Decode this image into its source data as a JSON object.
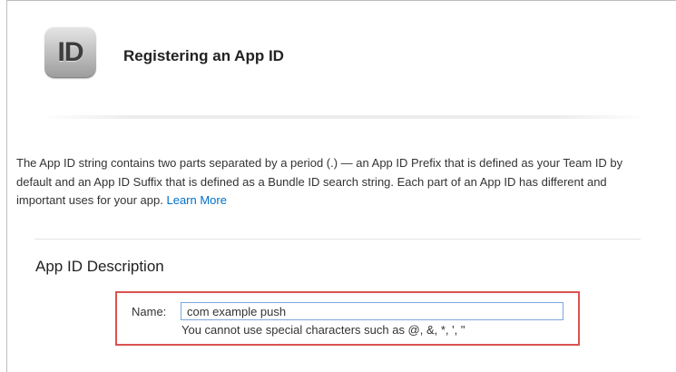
{
  "header": {
    "icon_text": "ID",
    "title": "Registering an App ID"
  },
  "intro": {
    "text": "The App ID string contains two parts separated by a period (.) — an App ID Prefix that is defined as your Team ID by default and an App ID Suffix that is defined as a Bundle ID search string. Each part of an App ID has different and important uses for your app. ",
    "link_label": "Learn More"
  },
  "description_section": {
    "title": "App ID Description",
    "name_label": "Name:",
    "name_value": "com example push",
    "hint": "You cannot use special characters such as @, &, *, ', \""
  },
  "colors": {
    "link": "#0070c9",
    "highlight_border": "#d9534f",
    "input_border": "#7aa7e0"
  }
}
